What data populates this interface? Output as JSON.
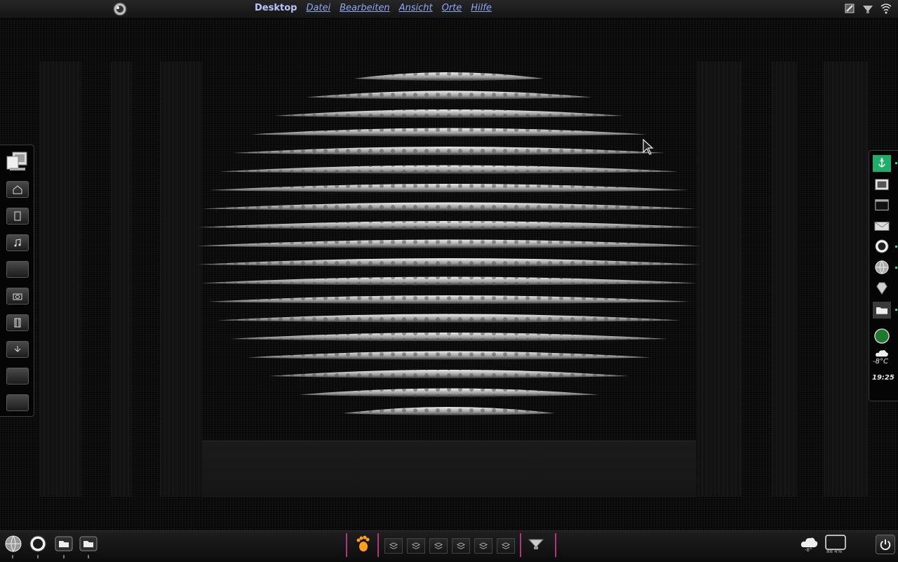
{
  "menubar": {
    "title": "Desktop",
    "items": [
      "Datei",
      "Bearbeiten",
      "Ansicht",
      "Orte",
      "Hilfe"
    ]
  },
  "tray_icons": [
    "network-tools-icon",
    "download-icon",
    "wifi-icon"
  ],
  "left_dock": {
    "items": [
      {
        "name": "computer-icon"
      },
      {
        "name": "home-folder-icon"
      },
      {
        "name": "documents-folder-icon"
      },
      {
        "name": "music-folder-icon"
      },
      {
        "name": "folder-icon"
      },
      {
        "name": "pictures-folder-icon"
      },
      {
        "name": "videos-folder-icon"
      },
      {
        "name": "downloads-folder-icon"
      },
      {
        "name": "folder-icon"
      },
      {
        "name": "folder-icon"
      }
    ]
  },
  "right_dock": {
    "items": [
      {
        "name": "anchor-icon",
        "active": true
      },
      {
        "name": "screenshot-icon"
      },
      {
        "name": "terminal-icon"
      },
      {
        "name": "mail-icon"
      },
      {
        "name": "media-player-icon",
        "active": true
      },
      {
        "name": "globe-browser-icon",
        "active": true
      },
      {
        "name": "gem-icon"
      },
      {
        "name": "folder-icon",
        "active": true
      },
      {
        "name": "status-orb-icon"
      },
      {
        "name": "weather-cloud-icon"
      }
    ],
    "temperature": "-8°C",
    "clock": "19:25"
  },
  "bottom_bar": {
    "weather_temp": "-8°",
    "cpu_label": "88 4%",
    "workspace_count": 6
  },
  "colors": {
    "menu_title": "#b6c9ff",
    "menu_item": "#8fa7f2",
    "accent_green": "#35d07a",
    "panel_separator": "#b4357a",
    "foot_orange": "#ff9f1a"
  }
}
